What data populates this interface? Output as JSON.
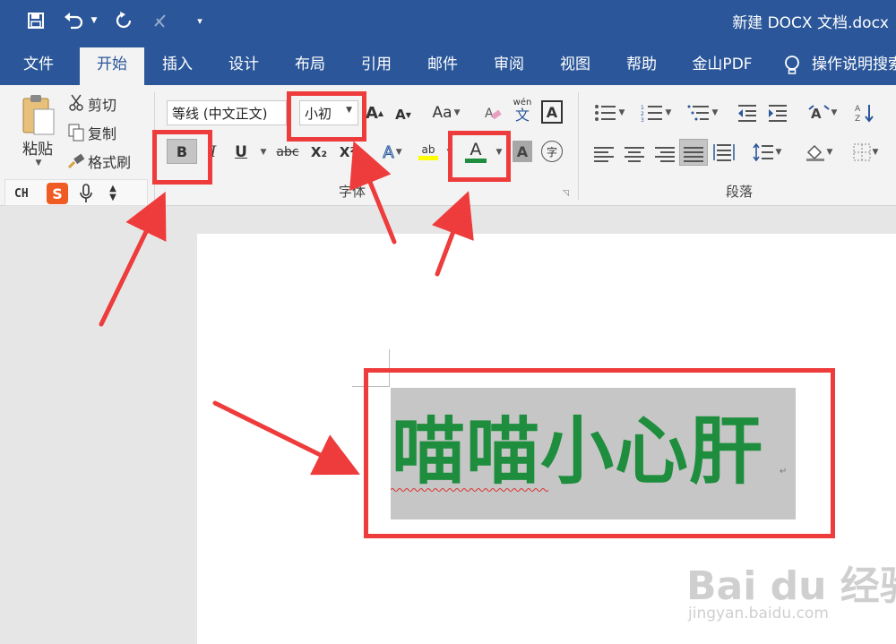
{
  "title_bar": {
    "document_title": "新建 DOCX 文档.docx",
    "quick_access": [
      "save-icon",
      "undo-icon",
      "undo-dropdown-icon",
      "redo-icon",
      "format-painter-icon",
      "customize-icon"
    ]
  },
  "tabs": [
    {
      "label": "文件"
    },
    {
      "label": "开始"
    },
    {
      "label": "插入"
    },
    {
      "label": "设计"
    },
    {
      "label": "布局"
    },
    {
      "label": "引用"
    },
    {
      "label": "邮件"
    },
    {
      "label": "审阅"
    },
    {
      "label": "视图"
    },
    {
      "label": "帮助"
    },
    {
      "label": "金山PDF"
    }
  ],
  "active_tab": "开始",
  "tell_me": "操作说明搜索",
  "clipboard": {
    "paste_label": "粘贴",
    "cut_label": "剪切",
    "copy_label": "复制",
    "format_painter_label": "格式刷"
  },
  "font_group": {
    "label": "字体",
    "font_name": "等线 (中文正文)",
    "font_size": "小初",
    "bold": "B",
    "italic": "I",
    "underline": "U",
    "strikethrough": "abc",
    "subscript": "X₂",
    "superscript": "X²",
    "change_case": "Aa",
    "phonetic": "wén",
    "phonetic_char": "文",
    "border_char": "A",
    "font_color": "A",
    "shading": "A",
    "enclose": "字",
    "highlight": "ab",
    "text_effect": "A",
    "grow": "A",
    "shrink": "A",
    "font_color_value": "#1e8e3e"
  },
  "paragraph_group": {
    "label": "段落"
  },
  "ime_bar": {
    "mode": "CH"
  },
  "document": {
    "text": "喵喵小心肝",
    "text_color": "#1e8e3e",
    "paragraph_mark": "↵"
  },
  "watermark": {
    "logo": "Bai du 经验",
    "url": "jingyan.baidu.com"
  }
}
